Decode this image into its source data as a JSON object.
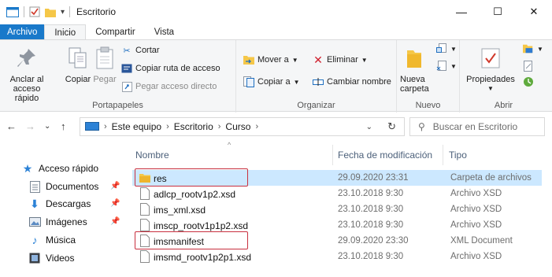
{
  "window": {
    "title": "Escritorio",
    "controls": {
      "minimize": "—",
      "maximize": "☐",
      "close": "✕"
    }
  },
  "ribbon_tabs": [
    {
      "label": "Archivo"
    },
    {
      "label": "Inicio"
    },
    {
      "label": "Compartir"
    },
    {
      "label": "Vista"
    }
  ],
  "ribbon": {
    "portapapeles": {
      "label": "Portapapeles",
      "anclar": "Anclar al",
      "anclar2": "acceso rápido",
      "copiar": "Copiar",
      "pegar": "Pegar",
      "cortar": "Cortar",
      "copiar_ruta": "Copiar ruta de acceso",
      "pegar_acceso": "Pegar acceso directo"
    },
    "organizar": {
      "label": "Organizar",
      "mover": "Mover a",
      "copiar_a": "Copiar a",
      "eliminar": "Eliminar",
      "cambiar_nombre": "Cambiar nombre"
    },
    "nuevo": {
      "label": "Nuevo",
      "nueva": "Nueva",
      "carpeta": "carpeta"
    },
    "abrir": {
      "label": "Abrir",
      "propiedades": "Propiedades"
    }
  },
  "address": {
    "crumbs": [
      "Este equipo",
      "Escritorio",
      "Curso"
    ],
    "search_placeholder": "Buscar en Escritorio"
  },
  "nav_pane": {
    "items": [
      {
        "label": "Acceso rápido",
        "icon": "star-icon"
      },
      {
        "label": "Documentos",
        "icon": "documents-icon"
      },
      {
        "label": "Descargas",
        "icon": "downloads-icon"
      },
      {
        "label": "Imágenes",
        "icon": "pictures-icon"
      },
      {
        "label": "Música",
        "icon": "music-icon"
      },
      {
        "label": "Videos",
        "icon": "videos-icon"
      }
    ]
  },
  "file_list": {
    "headers": {
      "name": "Nombre",
      "date": "Fecha de modificación",
      "type": "Tipo"
    },
    "rows": [
      {
        "name": "res",
        "date": "29.09.2020 23:31",
        "type": "Carpeta de archivos",
        "kind": "folder",
        "selected": true,
        "highlighted": true
      },
      {
        "name": "adlcp_rootv1p2.xsd",
        "date": "23.10.2018 9:30",
        "type": "Archivo XSD",
        "kind": "file"
      },
      {
        "name": "ims_xml.xsd",
        "date": "23.10.2018 9:30",
        "type": "Archivo XSD",
        "kind": "file"
      },
      {
        "name": "imscp_rootv1p1p2.xsd",
        "date": "23.10.2018 9:30",
        "type": "Archivo XSD",
        "kind": "file"
      },
      {
        "name": "imsmanifest",
        "date": "29.09.2020 23:30",
        "type": "XML Document",
        "kind": "file",
        "highlighted": true
      },
      {
        "name": "imsmd_rootv1p2p1.xsd",
        "date": "23.10.2018 9:30",
        "type": "Archivo XSD",
        "kind": "file"
      }
    ]
  },
  "colors": {
    "accent": "#1979ca",
    "selection": "#cce8ff",
    "highlight_box": "#c8303f",
    "folder": "#f5c748"
  }
}
